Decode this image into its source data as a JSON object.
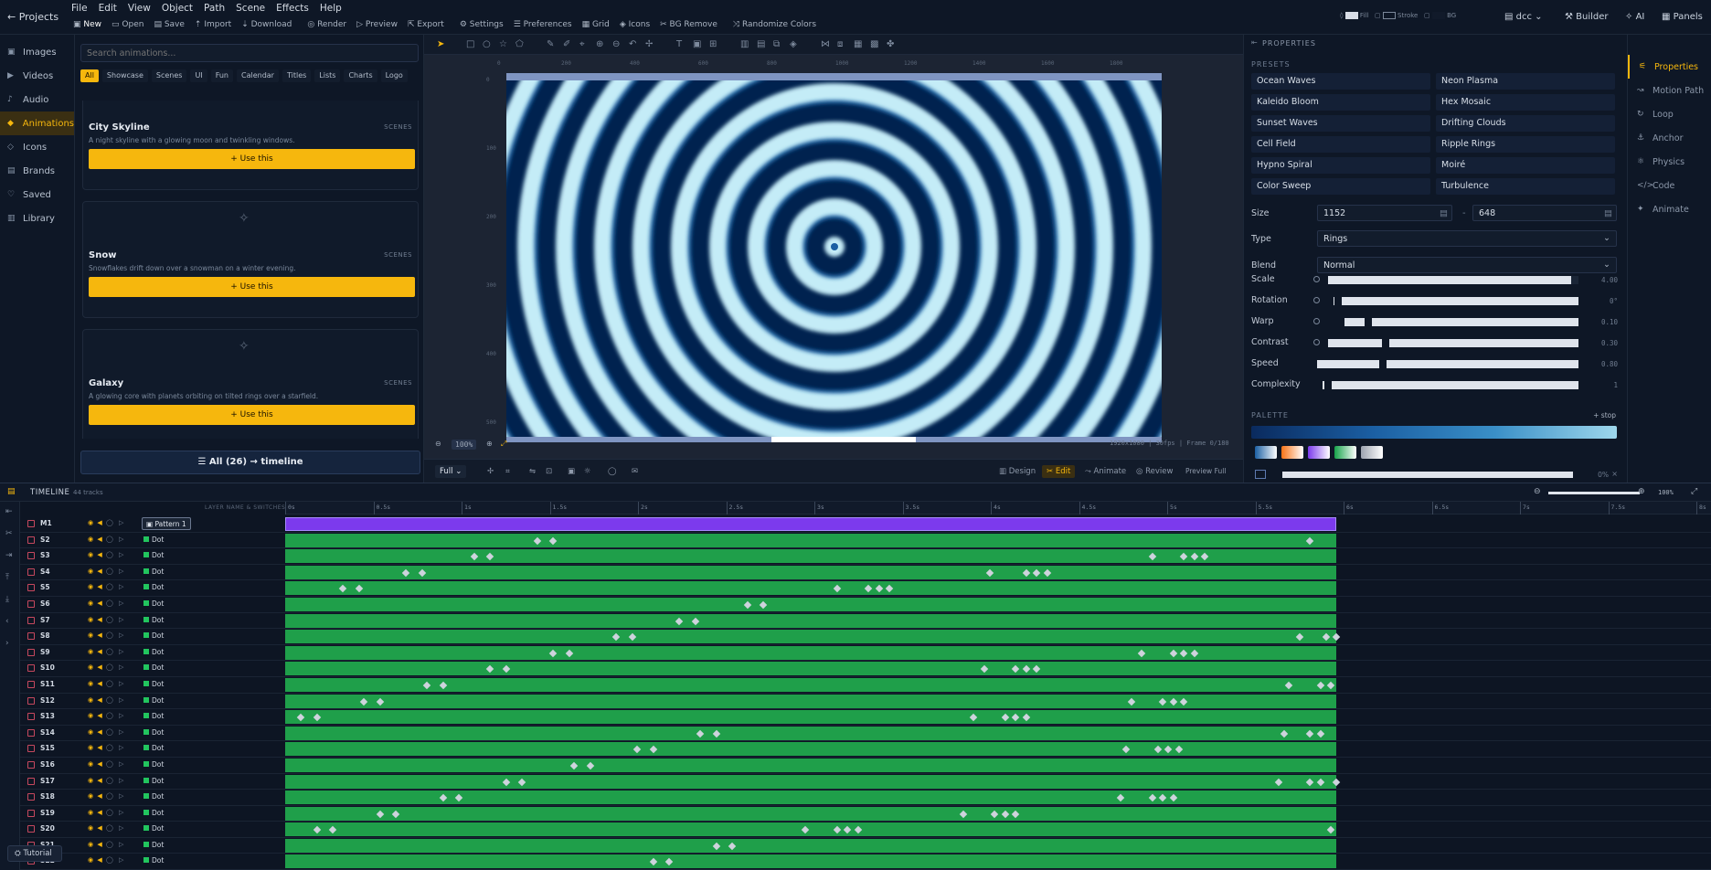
{
  "menubar": {
    "projects_label": "Projects",
    "menus": [
      "File",
      "Edit",
      "View",
      "Object",
      "Path",
      "Scene",
      "Effects",
      "Help"
    ],
    "tools": [
      "New",
      "Open",
      "Save",
      "Import",
      "Download",
      "Render",
      "Preview",
      "Export",
      "Settings",
      "Preferences",
      "Grid",
      "Icons",
      "BG Remove",
      "Randomize Colors"
    ],
    "fill_label": "Fill",
    "stroke_label": "Stroke",
    "bg_label": "BG",
    "workspace": "dcc",
    "builder_label": "Builder",
    "ai_label": "AI",
    "panels_label": "Panels"
  },
  "leftnav": {
    "items": [
      {
        "label": "Images",
        "icon": "image-icon"
      },
      {
        "label": "Videos",
        "icon": "video-icon"
      },
      {
        "label": "Audio",
        "icon": "audio-icon"
      },
      {
        "label": "Animations",
        "icon": "animation-icon",
        "active": true
      },
      {
        "label": "Icons",
        "icon": "icons-icon"
      },
      {
        "label": "Brands",
        "icon": "brand-icon"
      },
      {
        "label": "Saved",
        "icon": "bookmark-icon"
      },
      {
        "label": "Library",
        "icon": "library-icon"
      }
    ]
  },
  "library": {
    "search_placeholder": "Search animations...",
    "chips": [
      "All",
      "Showcase",
      "Scenes",
      "UI",
      "Fun",
      "Calendar",
      "Titles",
      "Lists",
      "Charts",
      "Logo"
    ],
    "cards": [
      {
        "title": "City Skyline",
        "category": "SCENES",
        "desc": "A night skyline with a glowing moon and twinkling windows.",
        "use": "Use this"
      },
      {
        "title": "Snow",
        "category": "SCENES",
        "desc": "Snowflakes drift down over a snowman on a winter evening.",
        "use": "Use this"
      },
      {
        "title": "Galaxy",
        "category": "SCENES",
        "desc": "A glowing core with planets orbiting on tilted rings over a starfield.",
        "use": "Use this"
      }
    ],
    "all_to_timeline": "All (26) → timeline"
  },
  "canvas": {
    "ruler_top": [
      "0",
      "200",
      "400",
      "600",
      "800",
      "1000",
      "1200",
      "1400",
      "1600",
      "1800"
    ],
    "ruler_left": [
      "0",
      "100",
      "200",
      "300",
      "400",
      "500"
    ],
    "zoom": "100%",
    "info": "1920x1080 | 30fps | Frame 0/180",
    "view_mode": "Full",
    "modes": [
      "Design",
      "Edit",
      "Animate",
      "Review"
    ],
    "preview_full": "Preview Full",
    "art_colors": {
      "light": "#c4ecf7",
      "dark": "#06244f",
      "mid": "#1b5fa3"
    }
  },
  "properties": {
    "header": "PROPERTIES",
    "presets_label": "PRESETS",
    "presets": [
      "Ocean Waves",
      "Neon Plasma",
      "Kaleido Bloom",
      "Hex Mosaic",
      "Sunset Waves",
      "Drifting Clouds",
      "Cell Field",
      "Ripple Rings",
      "Hypno Spiral",
      "Moiré",
      "Color Sweep",
      "Turbulence"
    ],
    "size_label": "Size",
    "size_w": "1152",
    "size_h": "648",
    "type_label": "Type",
    "type_value": "Rings",
    "blend_label": "Blend",
    "blend_value": "Normal",
    "sliders": [
      {
        "label": "Scale",
        "value": "4.00",
        "level": 0.97
      },
      {
        "label": "Rotation",
        "value": "0°",
        "level": 0.02
      },
      {
        "label": "Warp",
        "value": "0.10",
        "level": 0.1
      },
      {
        "label": "Contrast",
        "value": "0.30",
        "level": 0.23
      },
      {
        "label": "Speed",
        "value": "0.80",
        "level": 0.25
      },
      {
        "label": "Complexity",
        "value": "1",
        "level": 0.02
      }
    ],
    "palette_label": "PALETTE",
    "add_stop": "+ stop",
    "palette_swatches": [
      "#1b5fa3",
      "#f97316",
      "#7c3aed",
      "#16a34a",
      "#9ca3af"
    ],
    "bottom_value": "0%"
  },
  "right_tabs": [
    {
      "label": "Properties",
      "icon": "sliders-icon",
      "active": true
    },
    {
      "label": "Motion Path",
      "icon": "path-icon"
    },
    {
      "label": "Loop",
      "icon": "loop-icon"
    },
    {
      "label": "Anchor",
      "icon": "anchor-icon"
    },
    {
      "label": "Physics",
      "icon": "physics-icon"
    },
    {
      "label": "Code",
      "icon": "code-icon"
    },
    {
      "label": "Animate",
      "icon": "animate-icon"
    }
  ],
  "timeline": {
    "title": "TIMELINE",
    "track_count": "44 tracks",
    "layer_header": "LAYER NAME & SWITCHES",
    "zoom": "100%",
    "ticks": [
      "0s",
      "0.5s",
      "1s",
      "1.5s",
      "2s",
      "2.5s",
      "3s",
      "3.5s",
      "4s",
      "4.5s",
      "5s",
      "5.5s",
      "6s",
      "6.5s",
      "7s",
      "7.5s",
      "8s"
    ],
    "pattern_row": {
      "name": "M1",
      "layer": "Pattern 1"
    },
    "tracks": [
      {
        "name": "S2",
        "layer": "Dot",
        "keys": [
          0.24,
          0.255,
          0.975
        ]
      },
      {
        "name": "S3",
        "layer": "Dot",
        "keys": [
          0.18,
          0.195,
          0.825,
          0.855,
          0.865,
          0.875
        ]
      },
      {
        "name": "S4",
        "layer": "Dot",
        "keys": [
          0.115,
          0.13,
          0.67,
          0.705,
          0.715,
          0.725
        ]
      },
      {
        "name": "S5",
        "layer": "Dot",
        "keys": [
          0.055,
          0.07,
          0.525,
          0.555,
          0.565,
          0.575
        ]
      },
      {
        "name": "S6",
        "layer": "Dot",
        "keys": [
          0.44,
          0.455
        ]
      },
      {
        "name": "S7",
        "layer": "Dot",
        "keys": [
          0.375,
          0.39
        ]
      },
      {
        "name": "S8",
        "layer": "Dot",
        "keys": [
          0.315,
          0.33,
          0.965,
          0.99,
          1.0
        ]
      },
      {
        "name": "S9",
        "layer": "Dot",
        "keys": [
          0.255,
          0.27,
          0.815,
          0.845,
          0.855,
          0.865
        ]
      },
      {
        "name": "S10",
        "layer": "Dot",
        "keys": [
          0.195,
          0.21,
          0.665,
          0.695,
          0.705,
          0.715
        ]
      },
      {
        "name": "S11",
        "layer": "Dot",
        "keys": [
          0.135,
          0.15,
          0.955,
          0.985,
          0.995
        ]
      },
      {
        "name": "S12",
        "layer": "Dot",
        "keys": [
          0.075,
          0.09,
          0.805,
          0.835,
          0.845,
          0.855
        ]
      },
      {
        "name": "S13",
        "layer": "Dot",
        "keys": [
          0.015,
          0.03,
          0.655,
          0.685,
          0.695,
          0.705
        ]
      },
      {
        "name": "S14",
        "layer": "Dot",
        "keys": [
          0.395,
          0.41,
          0.95,
          0.975,
          0.985
        ]
      },
      {
        "name": "S15",
        "layer": "Dot",
        "keys": [
          0.335,
          0.35,
          0.8,
          0.83,
          0.84,
          0.85
        ]
      },
      {
        "name": "S16",
        "layer": "Dot",
        "keys": [
          0.275,
          0.29
        ]
      },
      {
        "name": "S17",
        "layer": "Dot",
        "keys": [
          0.21,
          0.225,
          0.945,
          0.975,
          0.985,
          1.0
        ]
      },
      {
        "name": "S18",
        "layer": "Dot",
        "keys": [
          0.15,
          0.165,
          0.795,
          0.825,
          0.835,
          0.845
        ]
      },
      {
        "name": "S19",
        "layer": "Dot",
        "keys": [
          0.09,
          0.105,
          0.645,
          0.675,
          0.685,
          0.695
        ]
      },
      {
        "name": "S20",
        "layer": "Dot",
        "keys": [
          0.03,
          0.045,
          0.495,
          0.525,
          0.535,
          0.545,
          0.995
        ]
      },
      {
        "name": "S21",
        "layer": "Dot",
        "keys": [
          0.41,
          0.425
        ]
      },
      {
        "name": "S22",
        "layer": "Dot",
        "keys": [
          0.35,
          0.365
        ]
      }
    ],
    "tutorial_label": "Tutorial"
  }
}
